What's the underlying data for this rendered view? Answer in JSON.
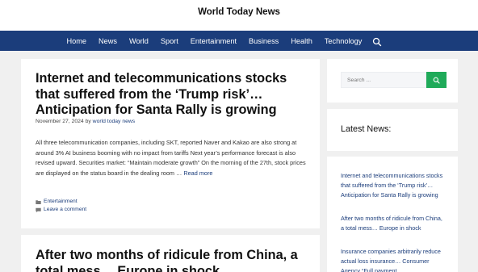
{
  "header": {
    "site_title": "World Today News"
  },
  "nav": {
    "items": [
      "Home",
      "News",
      "World",
      "Sport",
      "Entertainment",
      "Business",
      "Health",
      "Technology"
    ],
    "search_icon": "search-icon"
  },
  "post": {
    "title": "Internet and telecommunications stocks that suffered from the ‘Trump risk’… Anticipation for Santa Rally is growing",
    "date": "November 27, 2024",
    "by": "by",
    "author": "world today news",
    "excerpt": "All three telecommunication companies, including SKT, reported Naver and Kakao are also strong at around 3% AI business booming with no impact from tariffs Next year’s performance forecast is also revised upward. Securities market: “Maintain moderate growth” On the morning of the 27th, stock prices are displayed on the status board in the dealing room …",
    "read_more": "Read more",
    "category": "Entertainment",
    "comment": "Leave a comment"
  },
  "post2": {
    "title": "After two months of ridicule from China, a total mess… Europe in shock"
  },
  "sidebar": {
    "search_placeholder": "Search ...",
    "latest_title": "Latest News:",
    "latest_items": [
      "Internet and telecommunications stocks that suffered from the ‘Trump risk’… Anticipation for Santa Rally is growing",
      "After two months of ridicule from China, a total mess… Europe in shock",
      "Insurance companies arbitrarily reduce actual loss insurance… Consumer Agency “Full payment"
    ]
  },
  "colors": {
    "nav_bg": "#1b3d7b",
    "link": "#1b3d7b",
    "search_button": "#1faa59",
    "page_bg": "#f0f0f0"
  }
}
